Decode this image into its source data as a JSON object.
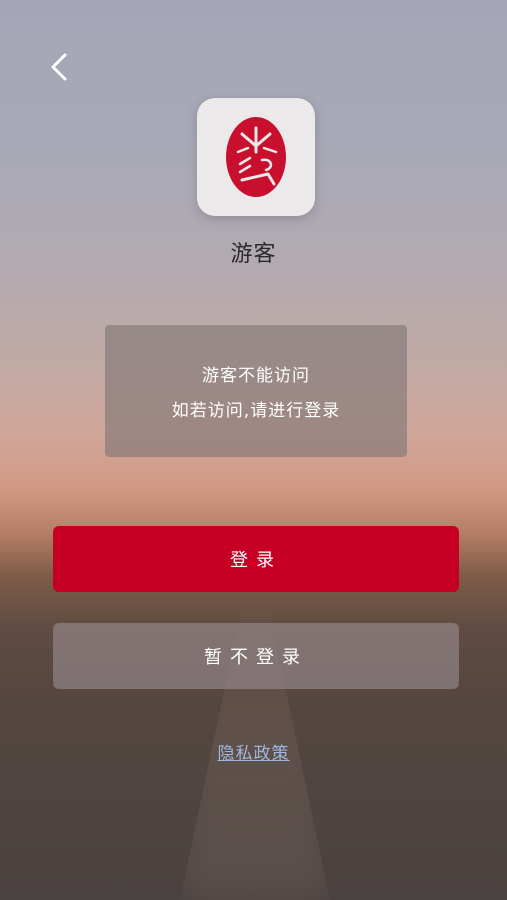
{
  "header": {
    "back_icon": "chevron-left-icon"
  },
  "profile": {
    "logo_icon": "red-seal-logo-icon",
    "name": "游客"
  },
  "notice": {
    "line1": "游客不能访问",
    "line2": "如若访问,请进行登录"
  },
  "buttons": {
    "login_label": "登录",
    "skip_label": "暂不登录"
  },
  "footer": {
    "privacy_link": "隐私政策"
  },
  "colors": {
    "accent": "#c50024",
    "link": "#9fb7dd"
  }
}
